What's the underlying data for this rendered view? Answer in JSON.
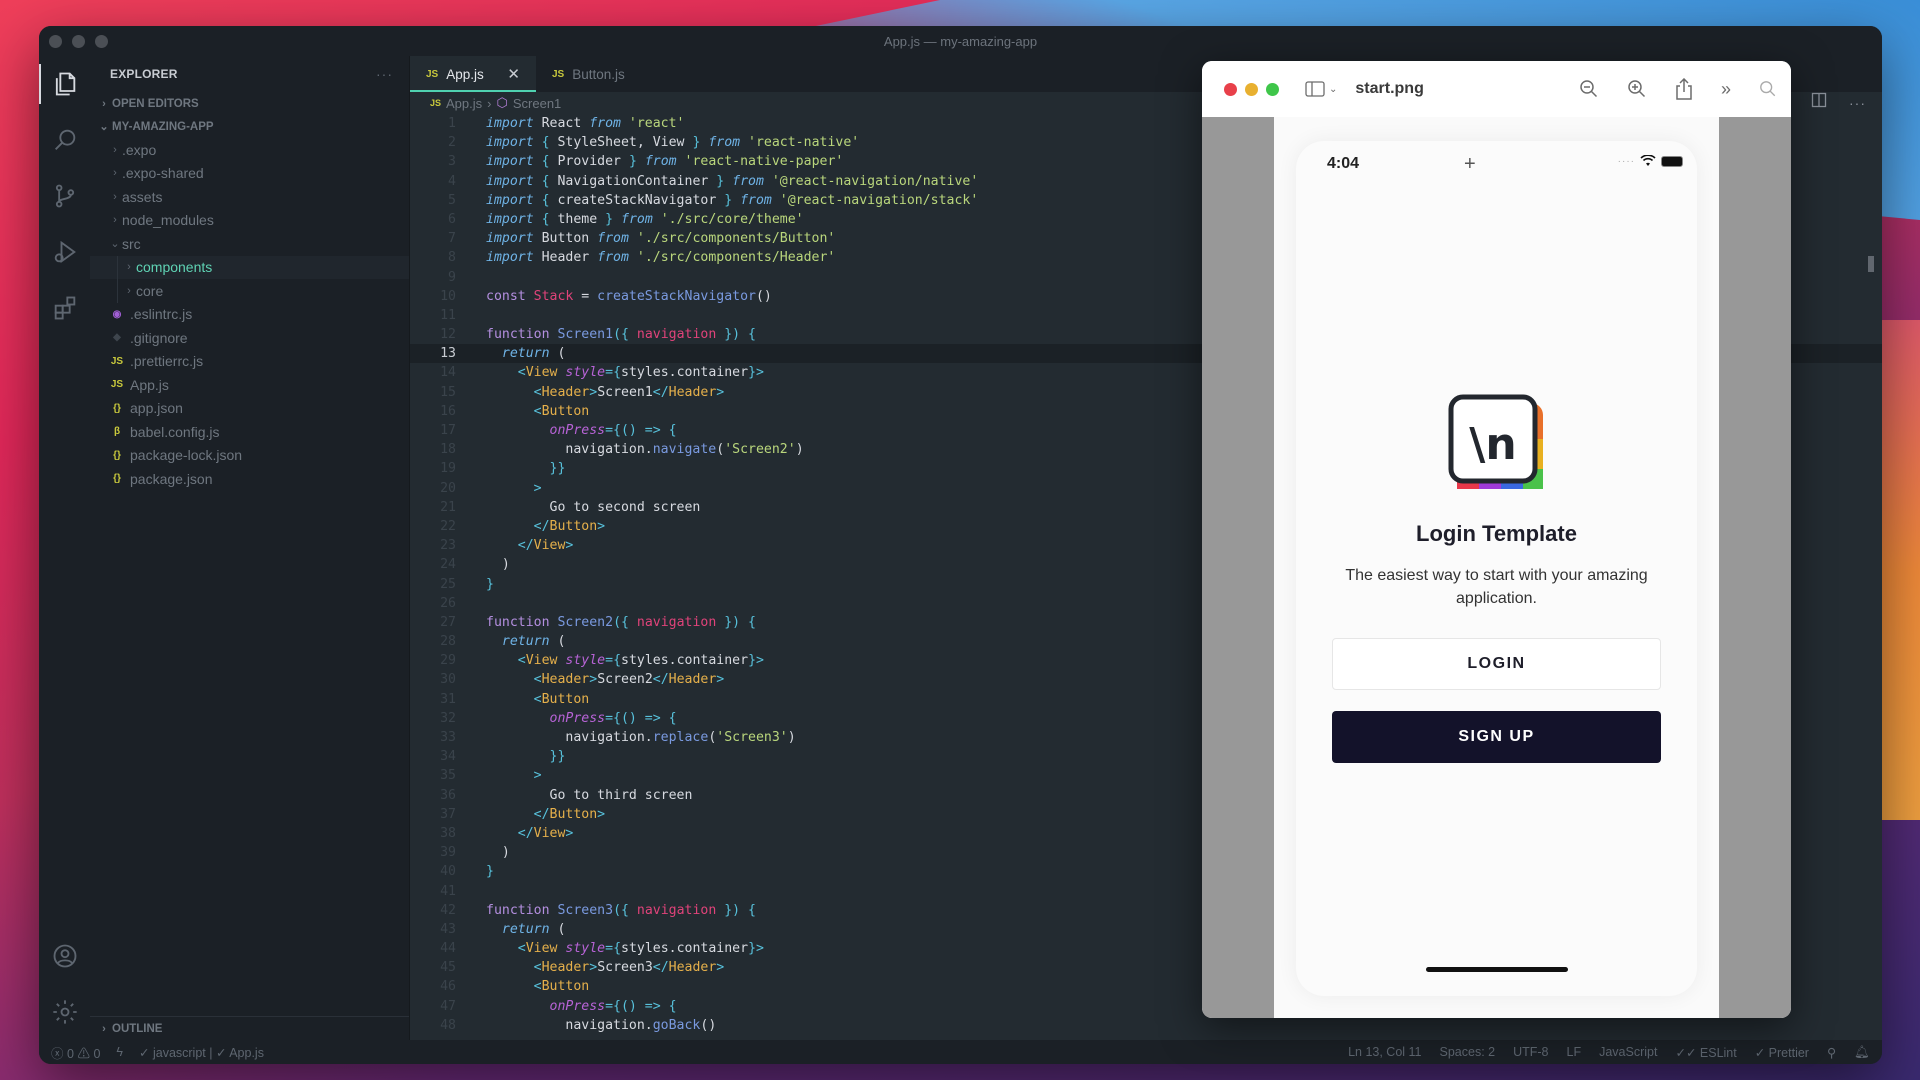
{
  "window": {
    "title": "App.js — my-amazing-app"
  },
  "activity_bar": {
    "top": [
      "explorer-icon",
      "search-icon",
      "source-control-icon",
      "run-debug-icon",
      "extensions-icon"
    ],
    "bottom": [
      "account-icon",
      "settings-gear-icon"
    ]
  },
  "sidebar": {
    "title": "EXPLORER",
    "more": "···",
    "open_editors": "OPEN EDITORS",
    "project": "MY-AMAZING-APP",
    "outline": "OUTLINE",
    "tree": [
      {
        "label": ".expo",
        "type": "folder",
        "depth": 1,
        "icon": ""
      },
      {
        "label": ".expo-shared",
        "type": "folder",
        "depth": 1,
        "icon": ""
      },
      {
        "label": "assets",
        "type": "folder",
        "depth": 1,
        "icon": ""
      },
      {
        "label": "node_modules",
        "type": "folder",
        "depth": 1,
        "icon": ""
      },
      {
        "label": "src",
        "type": "folder-open",
        "depth": 1,
        "icon": ""
      },
      {
        "label": "components",
        "type": "folder",
        "depth": 2,
        "icon": "",
        "selected": true
      },
      {
        "label": "core",
        "type": "folder",
        "depth": 2,
        "icon": ""
      },
      {
        "label": ".eslintrc.js",
        "type": "file",
        "depth": 1,
        "icon": "eslint-icon"
      },
      {
        "label": ".gitignore",
        "type": "file",
        "depth": 1,
        "icon": "git-icon"
      },
      {
        "label": ".prettierrc.js",
        "type": "file",
        "depth": 1,
        "icon": "js-icon"
      },
      {
        "label": "App.js",
        "type": "file",
        "depth": 1,
        "icon": "js-icon"
      },
      {
        "label": "app.json",
        "type": "file",
        "depth": 1,
        "icon": "json-icon"
      },
      {
        "label": "babel.config.js",
        "type": "file",
        "depth": 1,
        "icon": "babel-icon"
      },
      {
        "label": "package-lock.json",
        "type": "file",
        "depth": 1,
        "icon": "json-icon"
      },
      {
        "label": "package.json",
        "type": "file",
        "depth": 1,
        "icon": "json-icon"
      }
    ]
  },
  "tabs": [
    {
      "label": "App.js",
      "active": true,
      "badge": "JS",
      "close": "✕"
    },
    {
      "label": "Button.js",
      "active": false,
      "badge": "JS"
    }
  ],
  "breadcrumbs": {
    "badge": "JS",
    "file": "App.js",
    "separator": "›",
    "symbol": "Screen1"
  },
  "editor": {
    "current_line": 13,
    "lines": [
      {
        "n": 1,
        "tokens": [
          [
            "k",
            "import"
          ],
          [
            "t",
            " React "
          ],
          [
            "k",
            "from"
          ],
          [
            "s",
            " 'react'"
          ]
        ]
      },
      {
        "n": 2,
        "tokens": [
          [
            "k",
            "import"
          ],
          [
            "p",
            " { "
          ],
          [
            "t",
            "StyleSheet, View"
          ],
          [
            "p",
            " } "
          ],
          [
            "k",
            "from"
          ],
          [
            "s",
            " 'react-native'"
          ]
        ]
      },
      {
        "n": 3,
        "tokens": [
          [
            "k",
            "import"
          ],
          [
            "p",
            " { "
          ],
          [
            "t",
            "Provider"
          ],
          [
            "p",
            " } "
          ],
          [
            "k",
            "from"
          ],
          [
            "s",
            " 'react-native-paper'"
          ]
        ]
      },
      {
        "n": 4,
        "tokens": [
          [
            "k",
            "import"
          ],
          [
            "p",
            " { "
          ],
          [
            "t",
            "NavigationContainer"
          ],
          [
            "p",
            " } "
          ],
          [
            "k",
            "from"
          ],
          [
            "s",
            " '@react-navigation/native'"
          ]
        ]
      },
      {
        "n": 5,
        "tokens": [
          [
            "k",
            "import"
          ],
          [
            "p",
            " { "
          ],
          [
            "t",
            "createStackNavigator"
          ],
          [
            "p",
            " } "
          ],
          [
            "k",
            "from"
          ],
          [
            "s",
            " '@react-navigation/stack'"
          ]
        ]
      },
      {
        "n": 6,
        "tokens": [
          [
            "k",
            "import"
          ],
          [
            "p",
            " { "
          ],
          [
            "t",
            "theme"
          ],
          [
            "p",
            " } "
          ],
          [
            "k",
            "from"
          ],
          [
            "s",
            " './src/core/theme'"
          ]
        ]
      },
      {
        "n": 7,
        "tokens": [
          [
            "k",
            "import"
          ],
          [
            "t",
            " Button "
          ],
          [
            "k",
            "from"
          ],
          [
            "s",
            " './src/components/Button'"
          ]
        ]
      },
      {
        "n": 8,
        "tokens": [
          [
            "k",
            "import"
          ],
          [
            "t",
            " Header "
          ],
          [
            "k",
            "from"
          ],
          [
            "s",
            " './src/components/Header'"
          ]
        ]
      },
      {
        "n": 9,
        "tokens": []
      },
      {
        "n": 10,
        "tokens": [
          [
            "kw",
            "const"
          ],
          [
            "v",
            " Stack"
          ],
          [
            "t",
            " = "
          ],
          [
            "fn",
            "createStackNavigator"
          ],
          [
            "t",
            "()"
          ]
        ]
      },
      {
        "n": 11,
        "tokens": []
      },
      {
        "n": 12,
        "tokens": [
          [
            "kw",
            "function"
          ],
          [
            "fn",
            " Screen1"
          ],
          [
            "p",
            "({ "
          ],
          [
            "v",
            "navigation"
          ],
          [
            "p",
            " }) {"
          ]
        ]
      },
      {
        "n": 13,
        "tokens": [
          [
            "t",
            "  "
          ],
          [
            "k",
            "return"
          ],
          [
            "t",
            " ("
          ]
        ]
      },
      {
        "n": 14,
        "tokens": [
          [
            "t",
            "    "
          ],
          [
            "p",
            "<"
          ],
          [
            "tag",
            "View"
          ],
          [
            "attr",
            " style"
          ],
          [
            "p",
            "={"
          ],
          [
            "t",
            "styles.container"
          ],
          [
            "p",
            "}>"
          ]
        ]
      },
      {
        "n": 15,
        "tokens": [
          [
            "t",
            "      "
          ],
          [
            "p",
            "<"
          ],
          [
            "tag",
            "Header"
          ],
          [
            "p",
            ">"
          ],
          [
            "t",
            "Screen1"
          ],
          [
            "p",
            "</"
          ],
          [
            "tag",
            "Header"
          ],
          [
            "p",
            ">"
          ]
        ]
      },
      {
        "n": 16,
        "tokens": [
          [
            "t",
            "      "
          ],
          [
            "p",
            "<"
          ],
          [
            "tag",
            "Button"
          ]
        ]
      },
      {
        "n": 17,
        "tokens": [
          [
            "t",
            "        "
          ],
          [
            "attr",
            "onPress"
          ],
          [
            "p",
            "={() => {"
          ]
        ]
      },
      {
        "n": 18,
        "tokens": [
          [
            "t",
            "          navigation."
          ],
          [
            "fn",
            "navigate"
          ],
          [
            "t",
            "("
          ],
          [
            "s",
            "'Screen2'"
          ],
          [
            "t",
            ")"
          ]
        ]
      },
      {
        "n": 19,
        "tokens": [
          [
            "t",
            "        "
          ],
          [
            "p",
            "}}"
          ]
        ]
      },
      {
        "n": 20,
        "tokens": [
          [
            "t",
            "      "
          ],
          [
            "p",
            ">"
          ]
        ]
      },
      {
        "n": 21,
        "tokens": [
          [
            "t",
            "        Go to second screen"
          ]
        ]
      },
      {
        "n": 22,
        "tokens": [
          [
            "t",
            "      "
          ],
          [
            "p",
            "</"
          ],
          [
            "tag",
            "Button"
          ],
          [
            "p",
            ">"
          ]
        ]
      },
      {
        "n": 23,
        "tokens": [
          [
            "t",
            "    "
          ],
          [
            "p",
            "</"
          ],
          [
            "tag",
            "View"
          ],
          [
            "p",
            ">"
          ]
        ]
      },
      {
        "n": 24,
        "tokens": [
          [
            "t",
            "  )"
          ]
        ]
      },
      {
        "n": 25,
        "tokens": [
          [
            "p",
            "}"
          ]
        ]
      },
      {
        "n": 26,
        "tokens": []
      },
      {
        "n": 27,
        "tokens": [
          [
            "kw",
            "function"
          ],
          [
            "fn",
            " Screen2"
          ],
          [
            "p",
            "({ "
          ],
          [
            "v",
            "navigation"
          ],
          [
            "p",
            " }) {"
          ]
        ]
      },
      {
        "n": 28,
        "tokens": [
          [
            "t",
            "  "
          ],
          [
            "k",
            "return"
          ],
          [
            "t",
            " ("
          ]
        ]
      },
      {
        "n": 29,
        "tokens": [
          [
            "t",
            "    "
          ],
          [
            "p",
            "<"
          ],
          [
            "tag",
            "View"
          ],
          [
            "attr",
            " style"
          ],
          [
            "p",
            "={"
          ],
          [
            "t",
            "styles.container"
          ],
          [
            "p",
            "}>"
          ]
        ]
      },
      {
        "n": 30,
        "tokens": [
          [
            "t",
            "      "
          ],
          [
            "p",
            "<"
          ],
          [
            "tag",
            "Header"
          ],
          [
            "p",
            ">"
          ],
          [
            "t",
            "Screen2"
          ],
          [
            "p",
            "</"
          ],
          [
            "tag",
            "Header"
          ],
          [
            "p",
            ">"
          ]
        ]
      },
      {
        "n": 31,
        "tokens": [
          [
            "t",
            "      "
          ],
          [
            "p",
            "<"
          ],
          [
            "tag",
            "Button"
          ]
        ]
      },
      {
        "n": 32,
        "tokens": [
          [
            "t",
            "        "
          ],
          [
            "attr",
            "onPress"
          ],
          [
            "p",
            "={() => {"
          ]
        ]
      },
      {
        "n": 33,
        "tokens": [
          [
            "t",
            "          navigation."
          ],
          [
            "fn",
            "replace"
          ],
          [
            "t",
            "("
          ],
          [
            "s",
            "'Screen3'"
          ],
          [
            "t",
            ")"
          ]
        ]
      },
      {
        "n": 34,
        "tokens": [
          [
            "t",
            "        "
          ],
          [
            "p",
            "}}"
          ]
        ]
      },
      {
        "n": 35,
        "tokens": [
          [
            "t",
            "      "
          ],
          [
            "p",
            ">"
          ]
        ]
      },
      {
        "n": 36,
        "tokens": [
          [
            "t",
            "        Go to third screen"
          ]
        ]
      },
      {
        "n": 37,
        "tokens": [
          [
            "t",
            "      "
          ],
          [
            "p",
            "</"
          ],
          [
            "tag",
            "Button"
          ],
          [
            "p",
            ">"
          ]
        ]
      },
      {
        "n": 38,
        "tokens": [
          [
            "t",
            "    "
          ],
          [
            "p",
            "</"
          ],
          [
            "tag",
            "View"
          ],
          [
            "p",
            ">"
          ]
        ]
      },
      {
        "n": 39,
        "tokens": [
          [
            "t",
            "  )"
          ]
        ]
      },
      {
        "n": 40,
        "tokens": [
          [
            "p",
            "}"
          ]
        ]
      },
      {
        "n": 41,
        "tokens": []
      },
      {
        "n": 42,
        "tokens": [
          [
            "kw",
            "function"
          ],
          [
            "fn",
            " Screen3"
          ],
          [
            "p",
            "({ "
          ],
          [
            "v",
            "navigation"
          ],
          [
            "p",
            " }) {"
          ]
        ]
      },
      {
        "n": 43,
        "tokens": [
          [
            "t",
            "  "
          ],
          [
            "k",
            "return"
          ],
          [
            "t",
            " ("
          ]
        ]
      },
      {
        "n": 44,
        "tokens": [
          [
            "t",
            "    "
          ],
          [
            "p",
            "<"
          ],
          [
            "tag",
            "View"
          ],
          [
            "attr",
            " style"
          ],
          [
            "p",
            "={"
          ],
          [
            "t",
            "styles.container"
          ],
          [
            "p",
            "}>"
          ]
        ]
      },
      {
        "n": 45,
        "tokens": [
          [
            "t",
            "      "
          ],
          [
            "p",
            "<"
          ],
          [
            "tag",
            "Header"
          ],
          [
            "p",
            ">"
          ],
          [
            "t",
            "Screen3"
          ],
          [
            "p",
            "</"
          ],
          [
            "tag",
            "Header"
          ],
          [
            "p",
            ">"
          ]
        ]
      },
      {
        "n": 46,
        "tokens": [
          [
            "t",
            "      "
          ],
          [
            "p",
            "<"
          ],
          [
            "tag",
            "Button"
          ]
        ]
      },
      {
        "n": 47,
        "tokens": [
          [
            "t",
            "        "
          ],
          [
            "attr",
            "onPress"
          ],
          [
            "p",
            "={() => {"
          ]
        ]
      },
      {
        "n": 48,
        "tokens": [
          [
            "t",
            "          navigation."
          ],
          [
            "fn",
            "goBack"
          ],
          [
            "t",
            "()"
          ]
        ]
      }
    ]
  },
  "statusbar": {
    "errors": "0",
    "warnings": "0",
    "language_check": "✓ javascript | ✓ App.js",
    "position": "Ln 13, Col 11",
    "spaces": "Spaces: 2",
    "encoding": "UTF-8",
    "eol": "LF",
    "language": "JavaScript",
    "eslint": "✓✓ ESLint",
    "prettier": "✓ Prettier"
  },
  "preview": {
    "filename": "start.png",
    "traffic_colors": [
      "#e8404a",
      "#e8b030",
      "#3fc64a"
    ],
    "phone": {
      "time": "4:04",
      "logo_text": "\\n",
      "title": "Login Template",
      "subtitle": "The easiest way to start with your amazing application.",
      "login_label": "LOGIN",
      "signup_label": "SIGN UP"
    }
  },
  "colors": {
    "accent_tab": "#4fd1b0",
    "selected_folder": "#5fd3b4",
    "signup_bg": "#13122a"
  }
}
